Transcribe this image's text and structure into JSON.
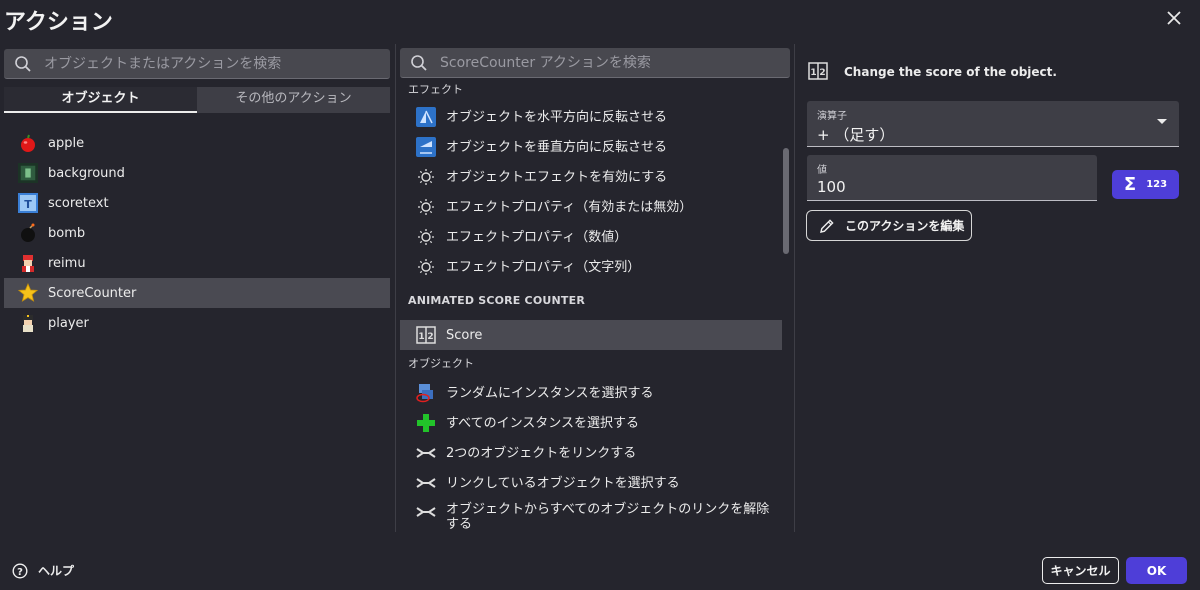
{
  "dialog": {
    "title": "アクション"
  },
  "left": {
    "search_placeholder": "オブジェクトまたはアクションを検索",
    "tabs": [
      "オブジェクト",
      "その他のアクション"
    ],
    "objects": [
      "apple",
      "background",
      "scoretext",
      "bomb",
      "reimu",
      "ScoreCounter",
      "player"
    ],
    "selected_object": "ScoreCounter"
  },
  "middle": {
    "search_placeholder": "ScoreCounter アクションを検索",
    "sections": [
      {
        "title": "エフェクト",
        "items": [
          {
            "label": "オブジェクトを水平方向に反転させる",
            "icon": "flip-horizontal-icon"
          },
          {
            "label": "オブジェクトを垂直方向に反転させる",
            "icon": "flip-vertical-icon"
          },
          {
            "label": "オブジェクトエフェクトを有効にする",
            "icon": "effect-icon"
          },
          {
            "label": "エフェクトプロパティ（有効または無効）",
            "icon": "effect-icon"
          },
          {
            "label": "エフェクトプロパティ（数値）",
            "icon": "effect-icon"
          },
          {
            "label": "エフェクトプロパティ（文字列）",
            "icon": "effect-icon"
          }
        ]
      },
      {
        "title": "ANIMATED SCORE COUNTER",
        "items": [
          {
            "label": "Score",
            "icon": "score-counter-icon"
          }
        ]
      },
      {
        "title": "オブジェクト",
        "items": [
          {
            "label": "ランダムにインスタンスを選択する",
            "icon": "random-pick-icon"
          },
          {
            "label": "すべてのインスタンスを選択する",
            "icon": "pick-all-icon"
          },
          {
            "label": "2つのオブジェクトをリンクする",
            "icon": "link-icon"
          },
          {
            "label": "リンクしているオブジェクトを選択する",
            "icon": "link-icon"
          },
          {
            "label": "オブジェクトからすべてのオブジェクトのリンクを解除する",
            "icon": "link-icon"
          }
        ]
      }
    ],
    "selected_action": "Score"
  },
  "right": {
    "description": "Change the score of the object.",
    "operator": {
      "label": "演算子",
      "value": "+ （足す）"
    },
    "value_field": {
      "label": "値",
      "value": "100"
    },
    "expression_button": "123",
    "edit_button": "このアクションを編集"
  },
  "footer": {
    "help": "ヘルプ",
    "cancel": "キャンセル",
    "ok": "OK"
  },
  "colors": {
    "accent": "#4e3ed8",
    "background": "#25252d",
    "selected": "#4a4a52"
  }
}
